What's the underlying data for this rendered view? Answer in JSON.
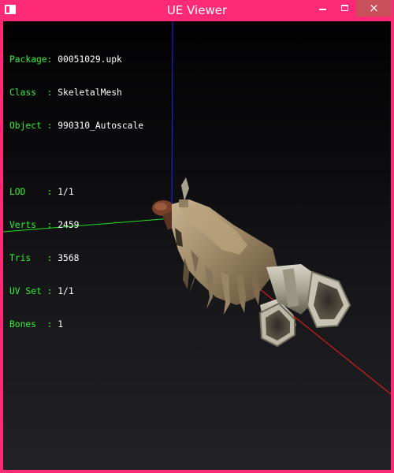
{
  "window": {
    "title": "UE Viewer",
    "close_glyph": "×",
    "accent_color": "#ff2a76",
    "close_color": "#c7505a"
  },
  "info": {
    "package": {
      "label": "Package:",
      "value": "00051029.upk"
    },
    "class": {
      "label": "Class  :",
      "value": "SkeletalMesh"
    },
    "object": {
      "label": "Object :",
      "value": "990310_Autoscale"
    },
    "lod": {
      "label": "LOD    :",
      "value": "1/1"
    },
    "verts": {
      "label": "Verts  :",
      "value": "2459"
    },
    "tris": {
      "label": "Tris   :",
      "value": "3568"
    },
    "uvset": {
      "label": "UV Set :",
      "value": "1/1"
    },
    "bones": {
      "label": "Bones  :",
      "value": "1"
    }
  },
  "colors": {
    "label": "#33ee33",
    "value": "#ffffff",
    "axis_x": "#ff1a1a",
    "axis_y": "#22dd22",
    "axis_z": "#2222ff"
  },
  "icons": [
    "app-icon",
    "minimize-icon",
    "maximize-icon",
    "close-icon"
  ]
}
